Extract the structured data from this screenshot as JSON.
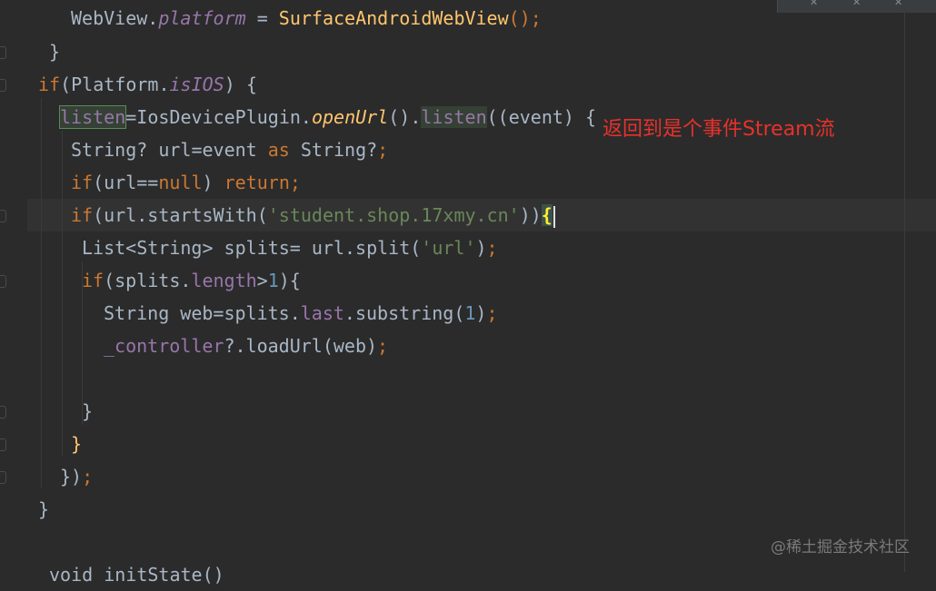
{
  "editor": {
    "lines": {
      "l0": {
        "a": "WebView.",
        "b": "platform",
        "c": " = ",
        "d": "SurfaceAndroidWebView",
        "e": "();"
      },
      "l1": {
        "a": "}"
      },
      "l2": {
        "a": "if",
        "b": "(Platform.",
        "c": "isIOS",
        "d": ") {"
      },
      "l3": {
        "a": "listen",
        "b": "=IosDevicePlugin.",
        "c": "openUrl",
        "d": "().",
        "e": "listen",
        "f": "((event) {"
      },
      "l4": {
        "a": "String? url=event ",
        "b": "as",
        "c": " String?",
        "d": ";"
      },
      "l5": {
        "a": "if",
        "b": "(url==",
        "c": "null",
        "d": ") ",
        "e": "return",
        "f": ";"
      },
      "l6": {
        "a": "if",
        "b": "(url.startsWith(",
        "c": "'student.shop.17xmy.cn'",
        "d": "))",
        "e": "{"
      },
      "l7": {
        "a": "List<String> splits= url.split(",
        "b": "'url'",
        "c": ")",
        "d": ";"
      },
      "l8": {
        "a": "if",
        "b": "(splits.",
        "c": "length",
        "d": ">",
        "e": "1",
        "f": "){"
      },
      "l9": {
        "a": "String web=splits.",
        "b": "last",
        "c": ".substring(",
        "d": "1",
        "e": ")",
        "f": ";"
      },
      "l10": {
        "a": "_controller",
        "b": "?.loadUrl(web)",
        "c": ";"
      },
      "l12": {
        "a": "}"
      },
      "l13": {
        "a": "}"
      },
      "l14": {
        "a": "})",
        "b": ";"
      },
      "l15": {
        "a": "}"
      },
      "l17": {
        "a": "void initState()"
      }
    }
  },
  "annotation": "返回到是个事件Stream流",
  "watermark": "@稀土掘金技术社区",
  "colors": {
    "background": "#2b2b2b",
    "keyword": "#cc7832",
    "string": "#6a8759",
    "number": "#6897bb",
    "property": "#9876aa",
    "function": "#ffc66d",
    "annotation_red": "#e8312b"
  }
}
